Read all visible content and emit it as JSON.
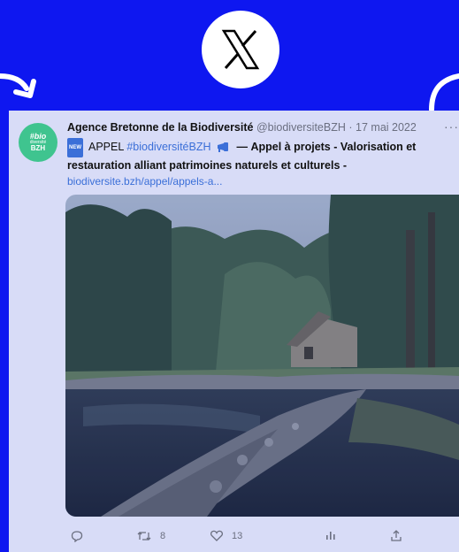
{
  "colors": {
    "background": "#0e17f0",
    "card": "#d8dcf7",
    "avatar": "#3fc48f",
    "link": "#3b6fd8"
  },
  "logo": {
    "icon": "x-logo-icon"
  },
  "tweet": {
    "avatar": {
      "line1": "#bio",
      "line2": "diversité",
      "line3": "BZH"
    },
    "author_name": "Agence Bretonne de la Biodiversité",
    "handle": "@biodiversiteBZH",
    "separator": "·",
    "date": "17 mai 2022",
    "more": "···",
    "badge": "NEW",
    "text_prefix": "APPEL",
    "hashtag": "#biodiversitéBZH",
    "dash": "—",
    "text_bold": "Appel à projets - Valorisation et restauration alliant patrimoines naturels et culturels -",
    "link": "biodiversite.bzh/appel/appels-a...",
    "photo_alt": "mill-by-river-photo",
    "actions": {
      "reply_count": "",
      "retweet_count": "8",
      "like_count": "13"
    }
  }
}
